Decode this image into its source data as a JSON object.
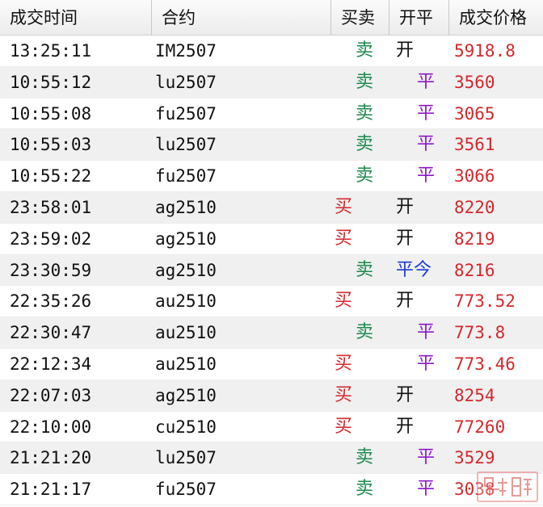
{
  "columns": {
    "time": "成交时间",
    "contract": "合约",
    "buy_sell": "买卖",
    "open_close": "开平",
    "price": "成交价格"
  },
  "rows": [
    {
      "time": "13:25:11",
      "contract": "IM2507",
      "bs": "卖",
      "oc": "开",
      "price": "5918.8"
    },
    {
      "time": "10:55:12",
      "contract": "lu2507",
      "bs": "卖",
      "oc": "平",
      "price": "3560"
    },
    {
      "time": "10:55:08",
      "contract": "fu2507",
      "bs": "卖",
      "oc": "平",
      "price": "3065"
    },
    {
      "time": "10:55:03",
      "contract": "lu2507",
      "bs": "卖",
      "oc": "平",
      "price": "3561"
    },
    {
      "time": "10:55:22",
      "contract": "fu2507",
      "bs": "卖",
      "oc": "平",
      "price": "3066"
    },
    {
      "time": "23:58:01",
      "contract": "ag2510",
      "bs": "买",
      "oc": "开",
      "price": "8220"
    },
    {
      "time": "23:59:02",
      "contract": "ag2510",
      "bs": "买",
      "oc": "开",
      "price": "8219"
    },
    {
      "time": "23:30:59",
      "contract": "ag2510",
      "bs": "卖",
      "oc": "平今",
      "price": "8216"
    },
    {
      "time": "22:35:26",
      "contract": "au2510",
      "bs": "买",
      "oc": "开",
      "price": "773.52"
    },
    {
      "time": "22:30:47",
      "contract": "au2510",
      "bs": "卖",
      "oc": "平",
      "price": "773.8"
    },
    {
      "time": "22:12:34",
      "contract": "au2510",
      "bs": "买",
      "oc": "平",
      "price": "773.46"
    },
    {
      "time": "22:07:03",
      "contract": "ag2510",
      "bs": "买",
      "oc": "开",
      "price": "8254"
    },
    {
      "time": "22:10:00",
      "contract": "cu2510",
      "bs": "买",
      "oc": "开",
      "price": "77260"
    },
    {
      "time": "21:21:20",
      "contract": "lu2507",
      "bs": "卖",
      "oc": "平",
      "price": "3529"
    },
    {
      "time": "21:21:17",
      "contract": "fu2507",
      "bs": "卖",
      "oc": "平",
      "price": "3038"
    }
  ],
  "colors": {
    "buy": "#d4282c",
    "sell": "#1c8a4c",
    "close": "#8d17c9",
    "close_today": "#1b38d6",
    "price": "#d4282c"
  },
  "watermark_icon": "stamp-logo-icon"
}
